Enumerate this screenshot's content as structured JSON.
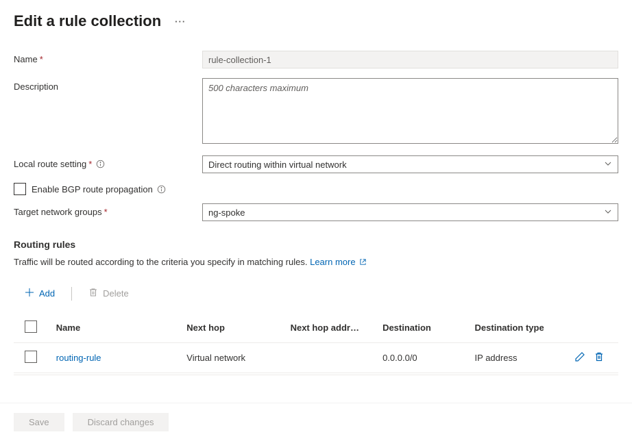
{
  "header": {
    "title": "Edit a rule collection",
    "more_label": "···"
  },
  "form": {
    "name_label": "Name",
    "name_value": "rule-collection-1",
    "description_label": "Description",
    "description_placeholder": "500 characters maximum",
    "local_route_label": "Local route setting",
    "local_route_value": "Direct routing within virtual network",
    "bgp_label": "Enable BGP route propagation",
    "target_groups_label": "Target network groups",
    "target_groups_value": "ng-spoke"
  },
  "rules": {
    "heading": "Routing rules",
    "subtext": "Traffic will be routed according to the criteria you specify in matching rules. ",
    "learn_more": "Learn more",
    "add_label": "Add",
    "delete_label": "Delete",
    "columns": {
      "name": "Name",
      "next_hop": "Next hop",
      "next_hop_addr": "Next hop addr…",
      "destination": "Destination",
      "destination_type": "Destination type"
    },
    "rows": [
      {
        "name": "routing-rule",
        "next_hop": "Virtual network",
        "next_hop_addr": "",
        "destination": "0.0.0.0/0",
        "destination_type": "IP address"
      }
    ]
  },
  "footer": {
    "save": "Save",
    "discard": "Discard changes"
  }
}
